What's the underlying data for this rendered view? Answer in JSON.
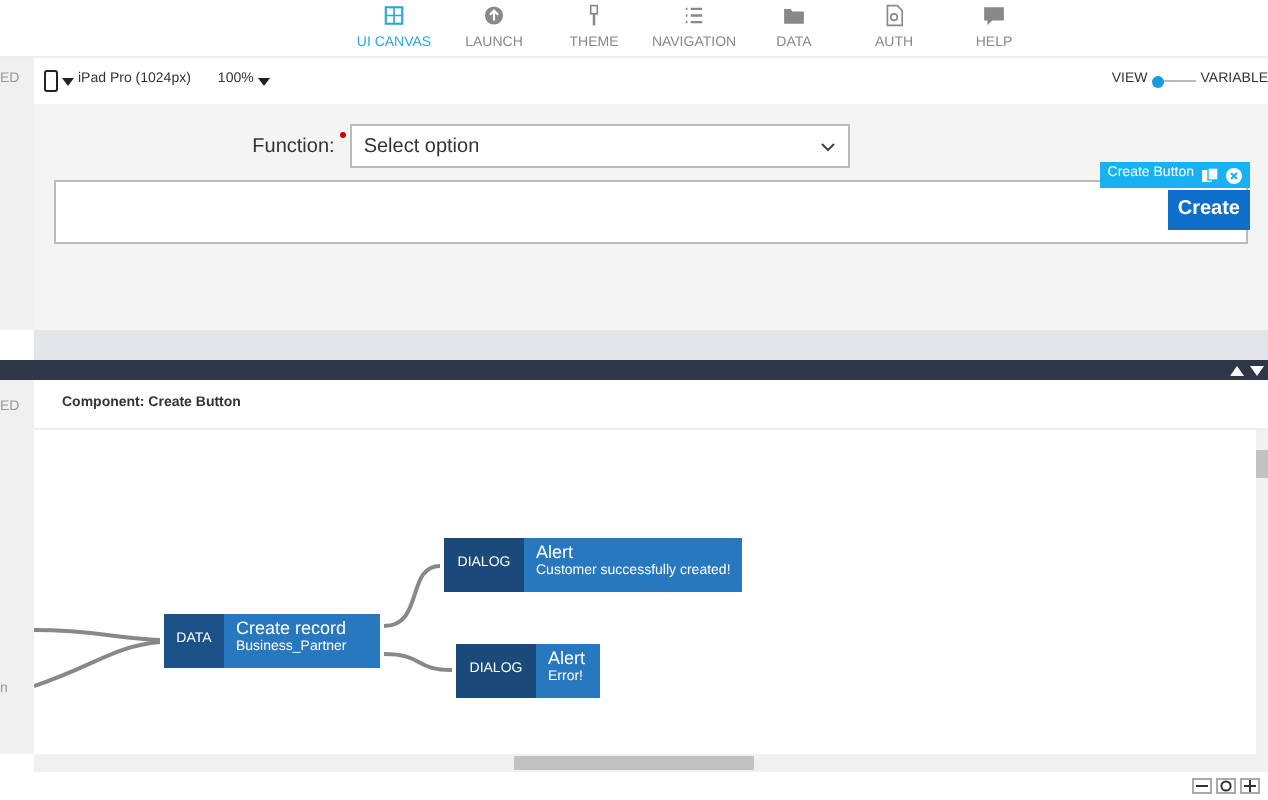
{
  "top_nav": [
    {
      "label": "UI CANVAS",
      "selected": true
    },
    {
      "label": "LAUNCH",
      "selected": false
    },
    {
      "label": "THEME",
      "selected": false
    },
    {
      "label": "NAVIGATION",
      "selected": false
    },
    {
      "label": "DATA",
      "selected": false
    },
    {
      "label": "AUTH",
      "selected": false
    },
    {
      "label": "HELP",
      "selected": false
    }
  ],
  "toolbar": {
    "device": "iPad Pro (1024px)",
    "zoom": "100%",
    "view_label": "VIEW",
    "variables_label": "VARIABLE",
    "variables_on": false
  },
  "sidebar_top": {
    "text": "ED"
  },
  "sidebar_bottom": {
    "text": "ED",
    "fragment": "n"
  },
  "form": {
    "label": "Function:",
    "required": true,
    "placeholder": "Select option"
  },
  "selected_component": {
    "tag": "Create Button",
    "button": "Create"
  },
  "flow_panel": {
    "title": "Component: Create Button",
    "nodes": [
      {
        "kind": "data",
        "type_label": "DATA",
        "title": "Create record",
        "subtitle": "Business_Partner"
      },
      {
        "kind": "dialog",
        "type_label": "DIALOG",
        "title": "Alert",
        "subtitle": "Customer successfully created!"
      },
      {
        "kind": "dialog",
        "type_label": "DIALOG",
        "title": "Alert",
        "subtitle": "Error!"
      }
    ]
  }
}
